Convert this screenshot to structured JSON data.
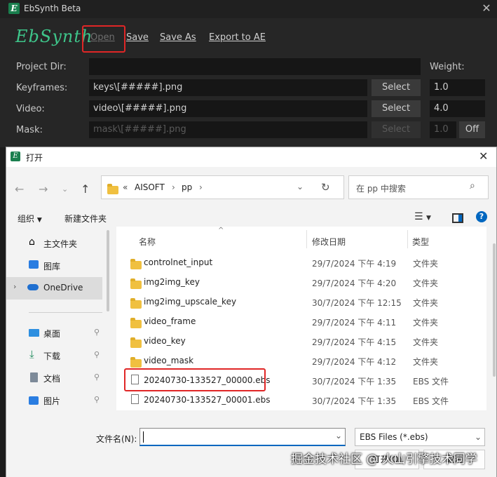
{
  "ebsynth": {
    "window_title": "EbSynth Beta",
    "logo_text": "EbSynth",
    "menu": {
      "open": "Open",
      "save": "Save",
      "save_as": "Save As",
      "export": "Export to AE"
    },
    "project_dir_label": "Project Dir:",
    "project_dir_value": "",
    "weight_label": "Weight:",
    "rows": [
      {
        "label": "Keyframes:",
        "value": "keys\\[#####].png",
        "button": "Select",
        "weight": "1.0"
      },
      {
        "label": "Video:",
        "value": "video\\[#####].png",
        "button": "Select",
        "weight": "4.0"
      },
      {
        "label": "Mask:",
        "value": "mask\\[#####].png",
        "button": "Select",
        "weight": "1.0",
        "toggle": "Off"
      }
    ]
  },
  "dialog": {
    "title": "打开",
    "address": {
      "prefix": "«",
      "segments": [
        "AISOFT",
        "pp"
      ]
    },
    "search_placeholder": "在 pp 中搜索",
    "toolbar": {
      "organize": "组织",
      "new_folder": "新建文件夹"
    },
    "sidebar": [
      {
        "label": "主文件夹",
        "icon": "home-icon"
      },
      {
        "label": "图库",
        "icon": "gallery-icon"
      },
      {
        "label": "OneDrive",
        "icon": "cloud-icon"
      },
      {
        "label": "桌面",
        "icon": "desktop-icon"
      },
      {
        "label": "下载",
        "icon": "download-icon"
      },
      {
        "label": "文档",
        "icon": "document-icon"
      },
      {
        "label": "图片",
        "icon": "picture-icon"
      }
    ],
    "columns": {
      "name": "名称",
      "date": "修改日期",
      "type": "类型"
    },
    "files": [
      {
        "name": "controlnet_input",
        "date": "29/7/2024 下午 4:19",
        "type": "文件夹",
        "kind": "folder"
      },
      {
        "name": "img2img_key",
        "date": "29/7/2024 下午 4:20",
        "type": "文件夹",
        "kind": "folder"
      },
      {
        "name": "img2img_upscale_key",
        "date": "30/7/2024 下午 12:15",
        "type": "文件夹",
        "kind": "folder"
      },
      {
        "name": "video_frame",
        "date": "29/7/2024 下午 4:11",
        "type": "文件夹",
        "kind": "folder"
      },
      {
        "name": "video_key",
        "date": "29/7/2024 下午 4:15",
        "type": "文件夹",
        "kind": "folder"
      },
      {
        "name": "video_mask",
        "date": "29/7/2024 下午 4:12",
        "type": "文件夹",
        "kind": "folder"
      },
      {
        "name": "20240730-133527_00000.ebs",
        "date": "30/7/2024 下午 1:35",
        "type": "EBS 文件",
        "kind": "file"
      },
      {
        "name": "20240730-133527_00001.ebs",
        "date": "30/7/2024 下午 1:35",
        "type": "EBS 文件",
        "kind": "file"
      }
    ],
    "filename_label": "文件名(N):",
    "filename_value": "",
    "filetype": "EBS Files (*.ebs)",
    "open_button": "打开(O)",
    "cancel_button": "取消"
  },
  "watermark": "掘金技术社区 @ 火山引擎技术同学"
}
